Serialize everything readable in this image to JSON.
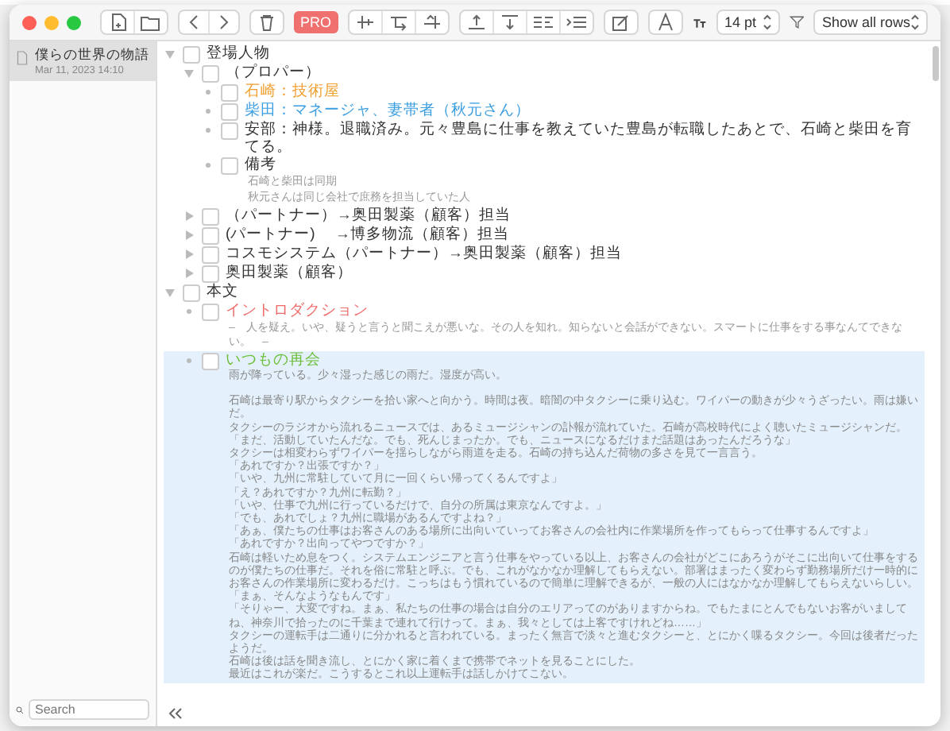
{
  "toolbar": {
    "pro_badge": "PRO",
    "font_size": "14 pt",
    "row_filter": "Show all rows"
  },
  "sidebar": {
    "documents": [
      {
        "title": "僕らの世界の物語",
        "date": "Mar 11, 2023 14:10",
        "selected": true
      }
    ],
    "search": {
      "placeholder": "Search"
    }
  },
  "outline": [
    {
      "label": "登場人物",
      "checked": false,
      "selected": false,
      "expanded": true,
      "children": [
        {
          "label": "（プロパー）",
          "checked": false,
          "selected": false,
          "expanded": true,
          "children": [
            {
              "label": "石崎：技術屋",
              "checked": false,
              "selected": false,
              "color": "#f0a030"
            },
            {
              "label": "柴田：マネージャ、妻帯者（秋元さん）",
              "checked": false,
              "selected": false,
              "color": "#3a9ee0"
            },
            {
              "label": "安部：神様。退職済み。元々豊島に仕事を教えていた豊島が転職したあとで、石崎と柴田を育てる。",
              "checked": false,
              "selected": false
            },
            {
              "label": "備考",
              "checked": false,
              "selected": false,
              "notes": [
                "石崎と柴田は同期",
                "秋元さんは同じ会社で庶務を担当していた人"
              ]
            }
          ]
        },
        {
          "label": "（パートナー）→奥田製薬（顧客）担当",
          "checked": false,
          "selected": false,
          "expanded": false
        },
        {
          "label": "(パートナー)　 →博多物流（顧客）担当",
          "checked": false,
          "selected": false,
          "expanded": false
        },
        {
          "label": "コスモシステム（パートナー）→奥田製薬（顧客）担当",
          "checked": false,
          "selected": false,
          "expanded": false
        },
        {
          "label": "奥田製薬（顧客）",
          "checked": false,
          "selected": false,
          "expanded": false
        }
      ]
    },
    {
      "label": "本文",
      "checked": false,
      "selected": false,
      "expanded": true,
      "children": [
        {
          "label": "イントロダクション",
          "checked": false,
          "selected": false,
          "color": "#f06a6a",
          "notes": [
            "–　人を疑え。いや、疑うと言うと聞こえが悪いな。その人を知れ。知らないと会話ができない。スマートに仕事をする事なんてできない。　–"
          ]
        },
        {
          "label": "いつもの再会",
          "checked": false,
          "selected": true,
          "color": "#6cbf3a",
          "body": [
            [
              "雨が降っている。少々湿った感じの雨だ。湿度が高い。"
            ],
            [
              "石崎は最寄り駅からタクシーを拾い家へと向かう。時間は夜。暗闇の中タクシーに乗り込む。ワイパーの動きが少々うざったい。雨は嫌いだ。",
              "タクシーのラジオから流れるニュースでは、あるミュージシャンの訃報が流れていた。石崎が高校時代によく聴いたミュージシャンだ。",
              "「まだ、活動していたんだな。でも、死んじまったか。でも、ニュースになるだけまだ話題はあったんだろうな」",
              "タクシーは相変わらずワイパーを揺らしながら雨道を走る。石崎の持ち込んだ荷物の多さを見て一言言う。",
              "「あれですか？出張ですか？」",
              "「いや、九州に常駐していて月に一回くらい帰ってくるんですよ」",
              "「え？あれですか？九州に転勤？」",
              "「いや、仕事で九州に行っているだけで、自分の所属は東京なんですよ。」",
              "「でも、あれでしょ？九州に職場があるんですよね？」",
              "「あぁ、僕たちの仕事はお客さんのある場所に出向いていってお客さんの会社内に作業場所を作ってもらって仕事するんですよ」",
              "「あれですか？出向ってやつですか？」",
              "石崎は軽いため息をつく。システムエンジニアと言う仕事をやっている以上、お客さんの会社がどこにあろうがそこに出向いて仕事をするのが僕たちの仕事だ。それを俗に常駐と呼ぶ。でも、これがなかなか理解してもらえない。部署はまったく変わらず勤務場所だけ一時的にお客さんの作業場所に変わるだけ。こっちはもう慣れているので簡単に理解できるが、一般の人にはなかなか理解してもらえないらしい。",
              "「まぁ、そんなようなもんです」",
              "「そりゃー、大変ですね。まぁ、私たちの仕事の場合は自分のエリアってのがありますからね。でもたまにとんでもないお客がいましてね、神奈川で拾ったのに千葉まで連れて行けって。まぁ、我々としては上客ですけれどね……」",
              "タクシーの運転手は二通りに分かれると言われている。まったく無言で淡々と進むタクシーと、とにかく喋るタクシー。今回は後者だったようだ。",
              "石崎は後は話を聞き流し、とにかく家に着くまで携帯でネットを見ることにした。",
              "最近はこれが楽だ。こうするとこれ以上運転手は話しかけてこない。"
            ]
          ]
        }
      ]
    }
  ]
}
